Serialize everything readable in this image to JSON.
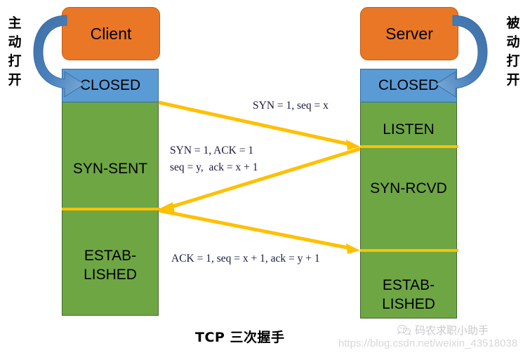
{
  "title": "TCP 三次握手",
  "colors": {
    "role_box": "#E97726",
    "closed_state": "#5B9BD5",
    "active_state": "#6EA644",
    "arrow_packet": "#FFC000",
    "arrow_open": "#4A81BE"
  },
  "side_labels": {
    "active_open": [
      "主",
      "动",
      "打",
      "开"
    ],
    "passive_open": [
      "被",
      "动",
      "打",
      "开"
    ]
  },
  "client": {
    "role": "Client",
    "states": [
      {
        "name": "CLOSED",
        "kind": "closed"
      },
      {
        "name": "SYN-SENT",
        "kind": "active"
      },
      {
        "name": "ESTAB-\nLISHED",
        "kind": "active"
      }
    ]
  },
  "server": {
    "role": "Server",
    "states": [
      {
        "name": "CLOSED",
        "kind": "closed"
      },
      {
        "name": "LISTEN",
        "kind": "active"
      },
      {
        "name": "SYN-RCVD",
        "kind": "active"
      },
      {
        "name": "ESTAB-\nLISHED",
        "kind": "active"
      }
    ]
  },
  "packets": [
    {
      "id": "syn",
      "direction": "client-to-server",
      "text": "SYN = 1, seq = x"
    },
    {
      "id": "syn-ack",
      "direction": "server-to-client",
      "text": "SYN = 1, ACK = 1\nseq = y,  ack = x + 1"
    },
    {
      "id": "ack",
      "direction": "client-to-server",
      "text": "ACK = 1, seq = x + 1, ack = y + 1"
    }
  ],
  "watermark": {
    "brand": "码农求职小助手",
    "url": "https://blog.csdn.net/weixin_43518038"
  }
}
